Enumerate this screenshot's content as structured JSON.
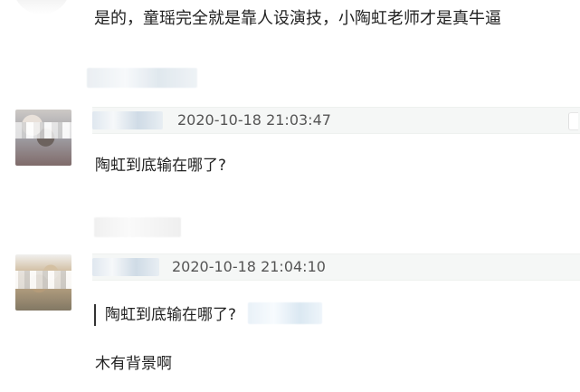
{
  "top_comment": {
    "text": "是的，童瑶完全就是靠人设演技，小陶虹老师才是真牛逼"
  },
  "comments": [
    {
      "timestamp": "2020-10-18 21:03:47",
      "text": "陶虹到底输在哪了?"
    },
    {
      "timestamp": "2020-10-18 21:04:10",
      "quote": "陶虹到底输在哪了?",
      "text": "木有背景啊"
    }
  ]
}
